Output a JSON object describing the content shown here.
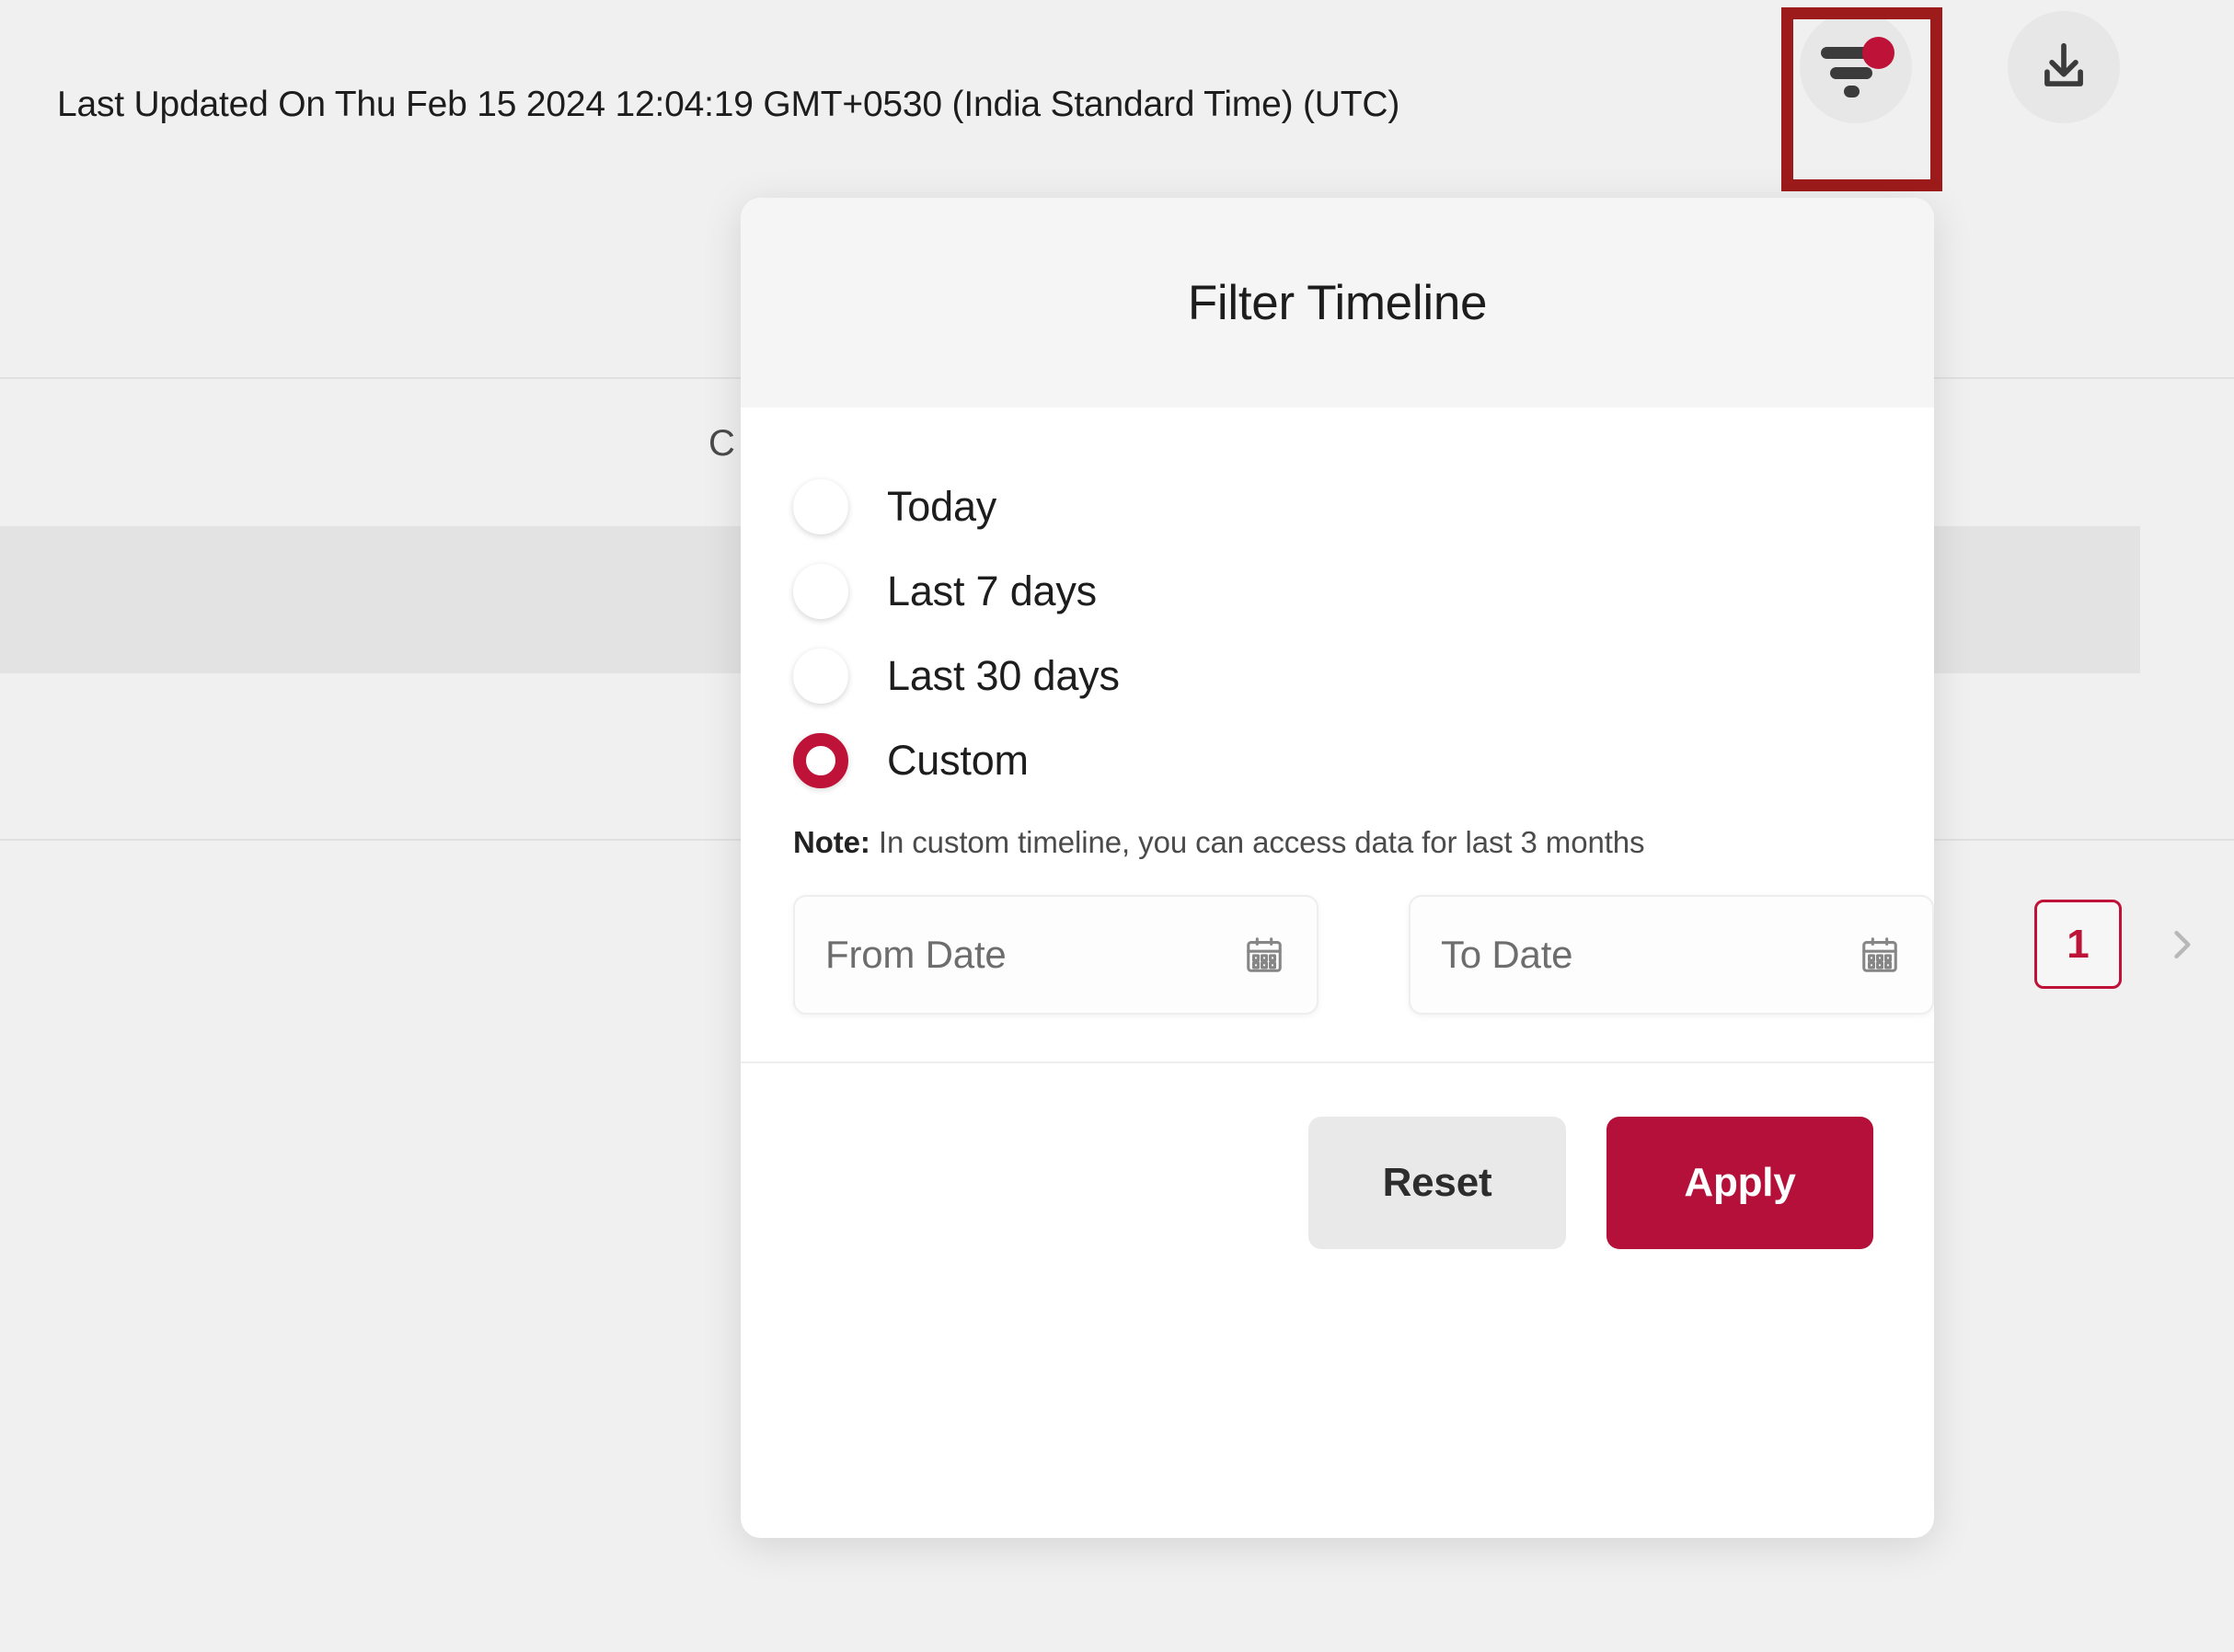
{
  "topbar": {
    "last_updated_label": "Last Updated On",
    "last_updated_value": "Thu Feb 15 2024 12:04:19 GMT+0530 (India Standard Time) (UTC)",
    "last_updated_full": "Last Updated On  Thu Feb 15 2024 12:04:19 GMT+0530 (India Standard Time) (UTC)",
    "filter_icon": "filter-icon",
    "filter_badge": "active-filter-dot",
    "download_icon": "download-icon"
  },
  "background": {
    "table_header_partial": "C",
    "pagination": {
      "current_page": "1",
      "next_icon": "chevron-right-icon"
    }
  },
  "modal": {
    "title": "Filter Timeline",
    "options": [
      {
        "id": "today",
        "label": "Today",
        "selected": false
      },
      {
        "id": "last-7-days",
        "label": "Last 7 days",
        "selected": false
      },
      {
        "id": "last-30-days",
        "label": "Last 30 days",
        "selected": false
      },
      {
        "id": "custom",
        "label": "Custom",
        "selected": true
      }
    ],
    "note_prefix": "Note:",
    "note_text": " In custom timeline, you can access data for last 3 months",
    "date_fields": [
      {
        "id": "from-date",
        "placeholder": "From Date",
        "value": "",
        "icon": "calendar-icon"
      },
      {
        "id": "to-date",
        "placeholder": "To Date",
        "value": "",
        "icon": "calendar-icon"
      }
    ],
    "buttons": {
      "reset_label": "Reset",
      "apply_label": "Apply"
    }
  },
  "colors": {
    "accent": "#be1238",
    "apply_button": "#b4103a",
    "focus_ring": "#9e1b1b",
    "page_background": "#f1f0f0",
    "modal_header": "#f5f5f5",
    "reset_button": "#e9e9e9"
  }
}
